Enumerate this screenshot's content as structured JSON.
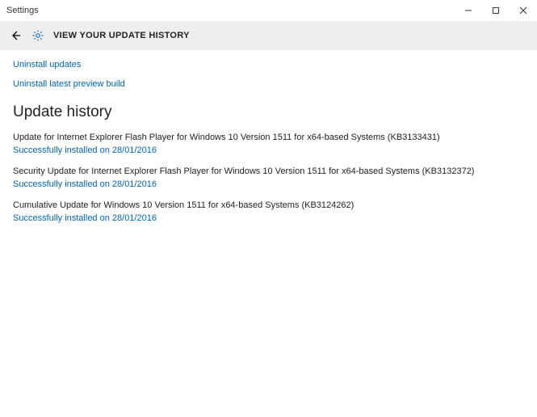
{
  "window": {
    "app_title": "Settings"
  },
  "header": {
    "page_title": "VIEW YOUR UPDATE HISTORY"
  },
  "links": {
    "uninstall_updates": "Uninstall updates",
    "uninstall_preview": "Uninstall latest preview build"
  },
  "section": {
    "heading": "Update history"
  },
  "updates": [
    {
      "title": "Update for Internet Explorer Flash Player for Windows 10 Version 1511 for x64-based Systems (KB3133431)",
      "status": "Successfully installed on 28/01/2016"
    },
    {
      "title": "Security Update for Internet Explorer Flash Player for Windows 10 Version 1511 for x64-based Systems (KB3132372)",
      "status": "Successfully installed on 28/01/2016"
    },
    {
      "title": "Cumulative Update for Windows 10 Version 1511 for x64-based Systems (KB3124262)",
      "status": "Successfully installed on 28/01/2016"
    }
  ]
}
